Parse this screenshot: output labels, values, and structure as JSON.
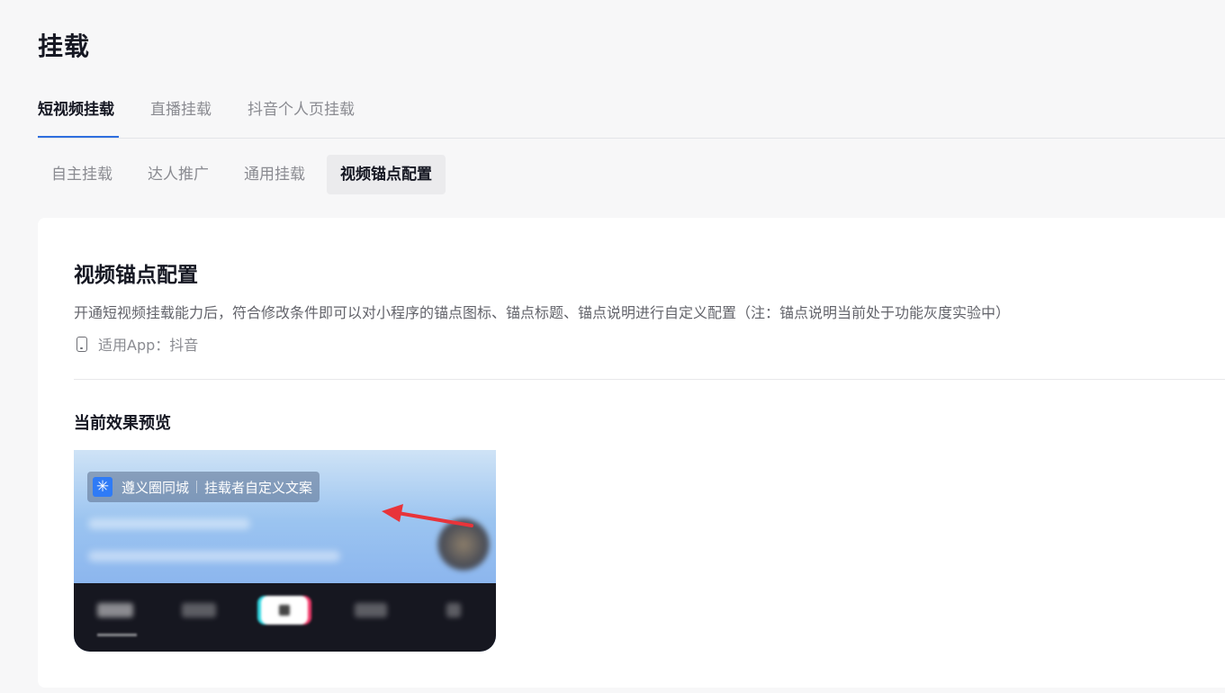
{
  "header": {
    "title": "挂载"
  },
  "main_tabs": [
    {
      "label": "短视频挂载",
      "active": true
    },
    {
      "label": "直播挂载",
      "active": false
    },
    {
      "label": "抖音个人页挂载",
      "active": false
    }
  ],
  "sub_tabs": [
    {
      "label": "自主挂载",
      "active": false
    },
    {
      "label": "达人推广",
      "active": false
    },
    {
      "label": "通用挂载",
      "active": false
    },
    {
      "label": "视频锚点配置",
      "active": true
    }
  ],
  "card": {
    "title": "视频锚点配置",
    "description": "开通短视频挂载能力后，符合修改条件即可以对小程序的锚点图标、锚点标题、锚点说明进行自定义配置（注：锚点说明当前处于功能灰度实验中）",
    "app_label": "适用App：抖音",
    "preview_title": "当前效果预览"
  },
  "preview": {
    "anchor_name": "遵义圈同城",
    "anchor_text": "挂载者自定义文案",
    "anchor_icon": "asterisk-icon"
  },
  "colors": {
    "accent": "#2f6fde",
    "arrow": "#e8343a",
    "anchor_icon_bg": "#2f7bf6"
  }
}
